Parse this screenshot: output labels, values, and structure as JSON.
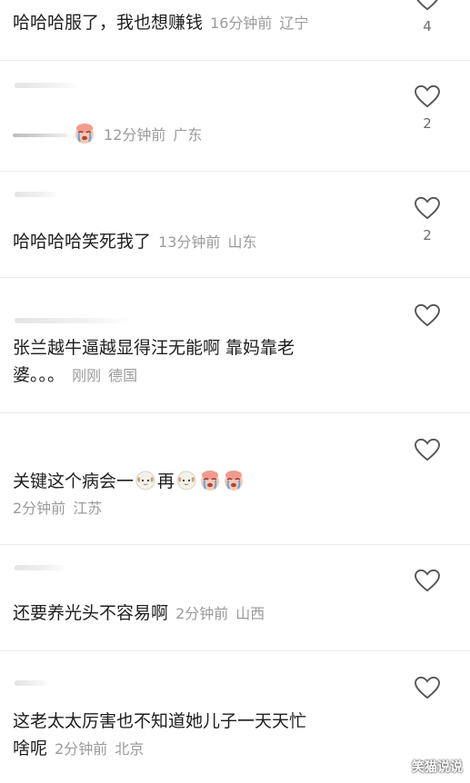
{
  "comments": [
    {
      "text": "哈哈哈服了，我也想赚钱",
      "time": "16分钟前",
      "region": "辽宁",
      "likes": "4"
    },
    {
      "text": "",
      "time": "12分钟前",
      "region": "广东",
      "likes": "2",
      "emoji": "crying-face-emoji"
    },
    {
      "text": "哈哈哈哈笑死我了",
      "time": "13分钟前",
      "region": "山东",
      "likes": "2"
    },
    {
      "text_line1": "张兰越牛逼越显得汪无能啊 靠妈靠老",
      "text_line2": "婆。。。",
      "time": "刚刚",
      "region": "德国",
      "likes": ""
    },
    {
      "text_a": "关键这个病会一",
      "text_b": "再",
      "emojis": [
        "sheep-emoji",
        "sheep-emoji",
        "crying-face-emoji",
        "crying-face-emoji"
      ],
      "time": "2分钟前",
      "region": "江苏",
      "likes": ""
    },
    {
      "text": "还要养光头不容易啊",
      "time": "2分钟前",
      "region": "山西",
      "likes": ""
    },
    {
      "text_line1": "这老太太厉害也不知道她儿子一天天忙",
      "text_line2": "啥呢",
      "time": "2分钟前",
      "region": "北京",
      "likes": ""
    }
  ],
  "watermark": "笑猫说说",
  "icons": {
    "like": "heart-outline-icon"
  },
  "colors": {
    "text": "#1e1e1e",
    "meta": "#9b9b9b",
    "divider": "#ececec",
    "heart_stroke": "#555555"
  }
}
